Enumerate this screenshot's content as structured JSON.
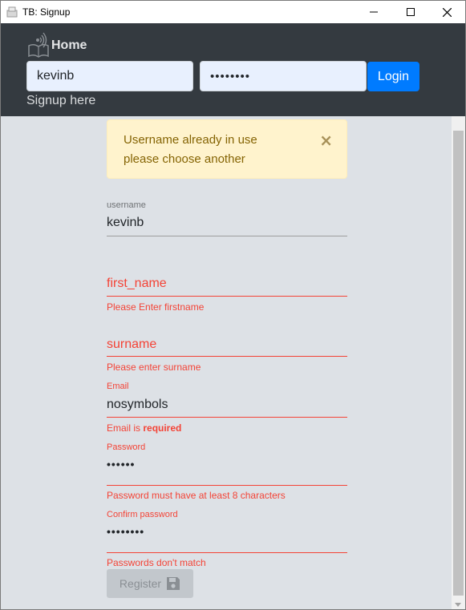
{
  "window": {
    "title": "TB: Signup"
  },
  "navbar": {
    "brand_label": "Home",
    "username_value": "kevinb",
    "password_value": "••••••••",
    "login_label": "Login",
    "signup_link": "Signup here"
  },
  "alert": {
    "line1": "Username already in use",
    "line2": "please choose another",
    "close_symbol": "×"
  },
  "form": {
    "username": {
      "label": "username",
      "value": "kevinb"
    },
    "first_name": {
      "placeholder": "first_name",
      "error": "Please Enter firstname"
    },
    "surname": {
      "placeholder": "surname",
      "error": "Please enter surname"
    },
    "email": {
      "label": "Email",
      "value": "nosymbols",
      "error_prefix": "Email is ",
      "error_strong": "required"
    },
    "password": {
      "label": "Password",
      "value": "••••••",
      "error": "Password must have at least 8 characters"
    },
    "confirm_password": {
      "label": "Confirm password",
      "value": "••••••••",
      "error": "Passwords don't match"
    },
    "register_label": "Register"
  },
  "colors": {
    "navbar": "#343a40",
    "primary": "#007bff",
    "error": "#f44336",
    "alert_bg": "#fff3cd",
    "alert_text": "#856404"
  },
  "icons": [
    "app-icon",
    "minimize-icon",
    "maximize-icon",
    "close-icon",
    "book-signal-icon",
    "floppy-disk-icon"
  ]
}
